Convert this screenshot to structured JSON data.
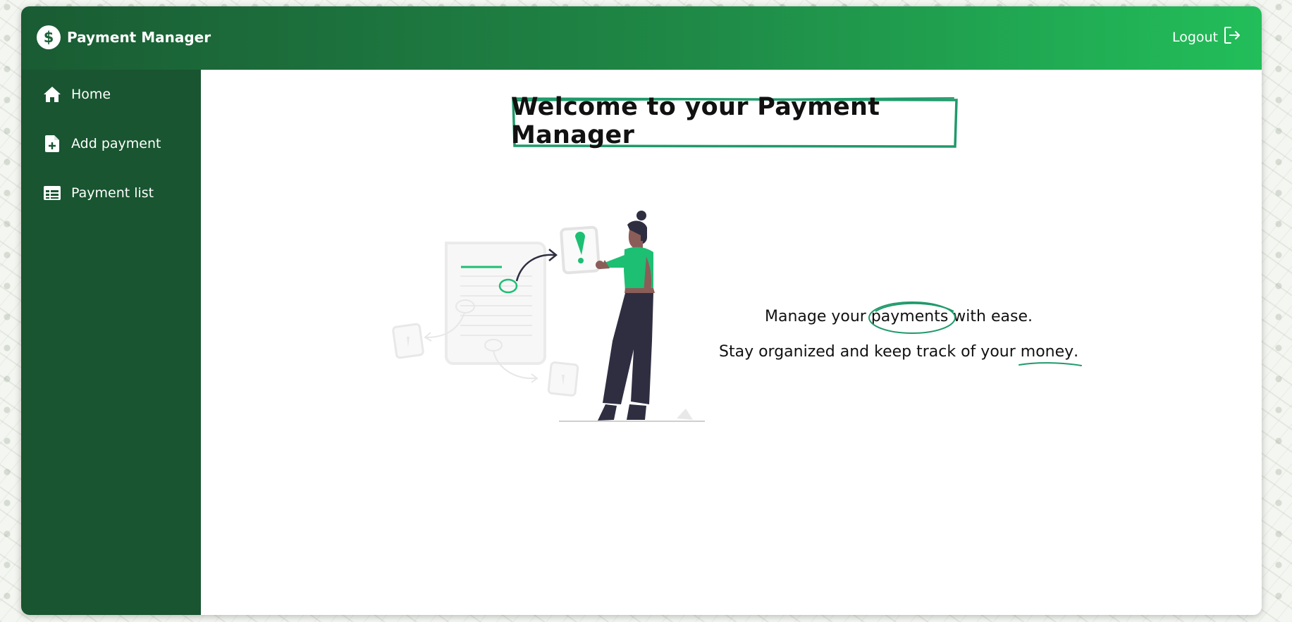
{
  "header": {
    "brand_icon": "$",
    "title": "Payment Manager",
    "logout_label": "Logout"
  },
  "sidebar": {
    "items": [
      {
        "label": "Home",
        "icon": "home-icon"
      },
      {
        "label": "Add payment",
        "icon": "file-plus-icon"
      },
      {
        "label": "Payment list",
        "icon": "table-icon"
      }
    ]
  },
  "main": {
    "heading": "Welcome to your Payment Manager",
    "tagline": {
      "l1_before": "Manage your ",
      "l1_highlight": "payments",
      "l1_after": " with ease.",
      "l2_before": "Stay organized and keep track of your ",
      "l2_highlight": "money",
      "l2_after": "."
    }
  },
  "colors": {
    "accent": "#1f9a6a",
    "sidebar": "#185530",
    "header_start": "#1a5b33",
    "header_end": "#22be5a",
    "figure_top": "#1dbf73",
    "figure_dark": "#2f2e41"
  }
}
